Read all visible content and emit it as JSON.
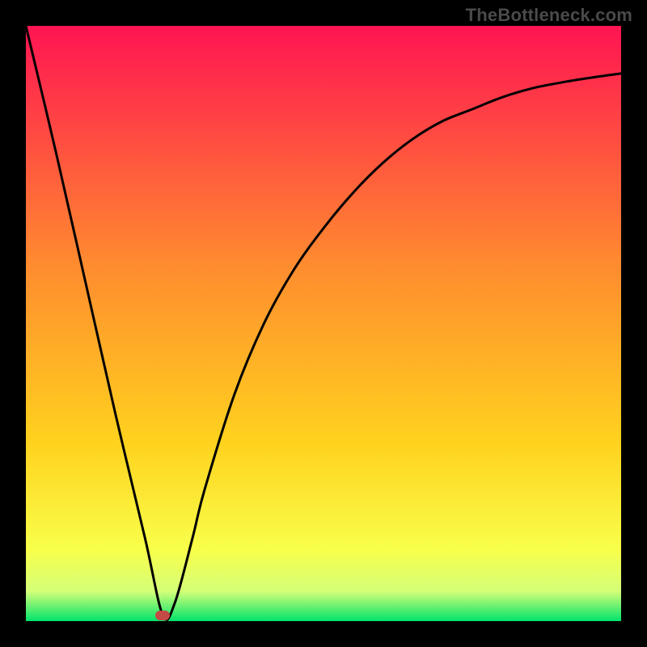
{
  "watermark": "TheBottleneck.com",
  "chart_data": {
    "type": "line",
    "title": "",
    "xlabel": "",
    "ylabel": "",
    "xlim": [
      0,
      100
    ],
    "ylim": [
      0,
      100
    ],
    "series": [
      {
        "name": "bottleneck-curve",
        "x": [
          0,
          5,
          10,
          15,
          20,
          23,
          25,
          28,
          30,
          35,
          40,
          45,
          50,
          55,
          60,
          65,
          70,
          75,
          80,
          85,
          90,
          95,
          100
        ],
        "values": [
          100,
          79,
          57,
          35,
          14,
          1,
          3,
          14,
          22,
          38,
          50,
          59,
          66,
          72,
          77,
          81,
          84,
          86,
          88,
          89.5,
          90.5,
          91.3,
          92
        ]
      }
    ],
    "minimum_point": {
      "x": 23,
      "y": 1
    },
    "background_gradient_stops": [
      {
        "offset": 0,
        "color": "#ff1452"
      },
      {
        "offset": 40,
        "color": "#ff8b2f"
      },
      {
        "offset": 70,
        "color": "#ffd21e"
      },
      {
        "offset": 88,
        "color": "#f8ff4a"
      },
      {
        "offset": 95,
        "color": "#d4ff78"
      },
      {
        "offset": 100,
        "color": "#00e36b"
      }
    ],
    "marker_color": "#c44a46",
    "curve_color": "#000000"
  }
}
